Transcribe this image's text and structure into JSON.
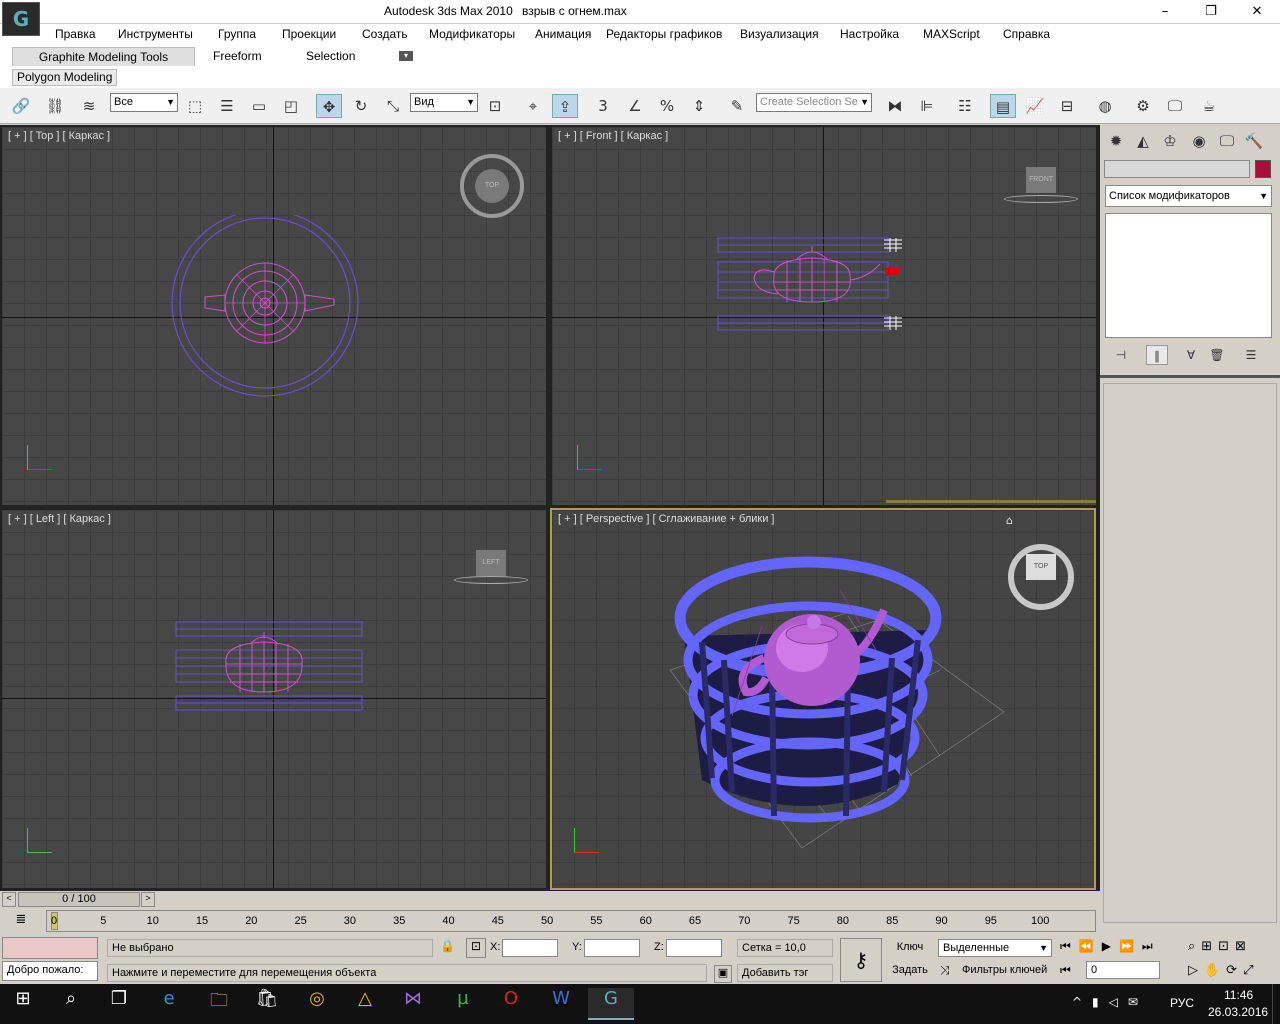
{
  "window": {
    "app_title": "Autodesk 3ds Max  2010",
    "file_title": "взрыв с огнем.max",
    "logo": "3ds-max-logo-icon"
  },
  "menu": [
    "Правка",
    "Инструменты",
    "Группа",
    "Проекции",
    "Создать",
    "Модификаторы",
    "Анимация",
    "Редакторы графиков",
    "Визуализация",
    "Настройка",
    "MAXScript",
    "Справка"
  ],
  "ribbon": {
    "tabs": [
      "Graphite Modeling Tools",
      "Freeform",
      "Selection"
    ],
    "panel": "Polygon Modeling"
  },
  "toolbar": {
    "selection_filter": "Все",
    "ref_coord": "Вид",
    "snap_label": "3",
    "named_selection_placeholder": "Create Selection Se"
  },
  "viewports": {
    "top": {
      "label": "[ + ] [ Top ] [ Каркас ]",
      "cube": "TOP"
    },
    "front": {
      "label": "[ + ] [ Front ] [ Каркас ]",
      "cube": "FRONT"
    },
    "left": {
      "label": "[ + ] [ Left ] [ Каркас ]",
      "cube": "LEFT"
    },
    "perspective": {
      "label": "[ + ] [ Perspective ] [ Сглаживание + блики ]",
      "cube": "TOP"
    }
  },
  "command_panel": {
    "modifier_list": "Список модификаторов",
    "object_color": "#a8103c"
  },
  "timeline": {
    "slider": "0 / 100",
    "ticks": [
      "0",
      "5",
      "10",
      "15",
      "20",
      "25",
      "30",
      "35",
      "40",
      "45",
      "50",
      "55",
      "60",
      "65",
      "70",
      "75",
      "80",
      "85",
      "90",
      "95",
      "100"
    ]
  },
  "status": {
    "selection": "Не выбрано",
    "prompt": "Нажмите и переместите для перемещения объекта",
    "listener": "Добро пожало:",
    "x_label": "X:",
    "y_label": "Y:",
    "z_label": "Z:",
    "grid": "Сетка = 10,0",
    "add_tag": "Добавить тэг врем",
    "key_label": "Ключ",
    "set_label": "Задать",
    "key_mode": "Выделенные",
    "key_filters": "Фильтры ключей",
    "frame": "0"
  },
  "taskbar": {
    "lang": "РУС",
    "time": "11:46",
    "date": "26.03.2016"
  }
}
